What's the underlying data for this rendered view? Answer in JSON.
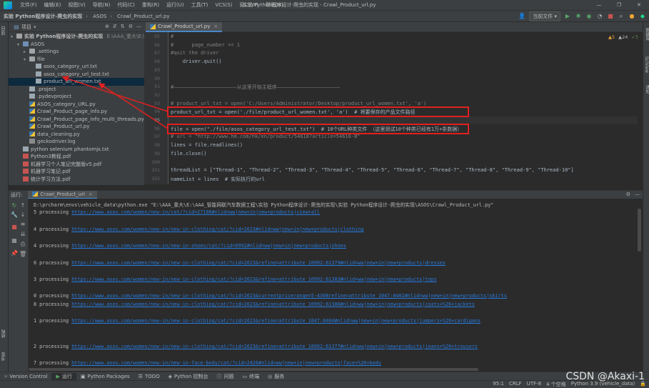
{
  "menubar": {
    "items": [
      "文件(F)",
      "编辑(E)",
      "视图(V)",
      "导航(N)",
      "代码(C)",
      "重构(R)",
      "运行(U)",
      "工具(T)",
      "VCS(S)",
      "窗口(W)",
      "帮助(H)"
    ],
    "title": "实验 Python程序设计-爬虫的实现 - Crawl_Product_url.py",
    "min": "—",
    "max": "❐",
    "close": "✕"
  },
  "navbar": {
    "crumbs": [
      "实验 Python程序设计-爬虫的实现",
      "ASOS",
      "Crawl_Product_url.py"
    ],
    "run_config": "当前文件 ▾"
  },
  "project": {
    "label": "项目",
    "root": "实验 Python程序设计-爬虫的实现",
    "root_path": "E:\\AAA_重大\\E:\\A",
    "items": [
      {
        "name": "ASOS",
        "indent": 1,
        "type": "folder-blue",
        "arrow": "▾"
      },
      {
        "name": ".settings",
        "indent": 2,
        "type": "folder",
        "arrow": "▸"
      },
      {
        "name": "file",
        "indent": 2,
        "type": "folder",
        "arrow": "▾"
      },
      {
        "name": "asos_category_url.txt",
        "indent": 3,
        "type": "txt",
        "arrow": ""
      },
      {
        "name": "asos_category_url_test.txt",
        "indent": 3,
        "type": "txt",
        "arrow": ""
      },
      {
        "name": "product_url_women.txt",
        "indent": 3,
        "type": "txt",
        "arrow": "",
        "selected": true
      },
      {
        "name": ".project",
        "indent": 2,
        "type": "txt",
        "arrow": ""
      },
      {
        "name": ".pydevproject",
        "indent": 2,
        "type": "txt",
        "arrow": ""
      },
      {
        "name": "ASOS_category_URL.py",
        "indent": 2,
        "type": "py",
        "arrow": ""
      },
      {
        "name": "Crawl_Product_page_info.py",
        "indent": 2,
        "type": "py",
        "arrow": ""
      },
      {
        "name": "Crawl_Product_page_info_multi_threads.py",
        "indent": 2,
        "type": "py",
        "arrow": ""
      },
      {
        "name": "Crawl_Product_url.py",
        "indent": 2,
        "type": "py",
        "arrow": ""
      },
      {
        "name": "data_cleaning.py",
        "indent": 2,
        "type": "py",
        "arrow": ""
      },
      {
        "name": "geckodriver.log",
        "indent": 2,
        "type": "log",
        "arrow": ""
      },
      {
        "name": "python selenium phantomjs.txt",
        "indent": 1,
        "type": "txt",
        "arrow": ""
      },
      {
        "name": "Python3教程.pdf",
        "indent": 1,
        "type": "pdf",
        "arrow": ""
      },
      {
        "name": "机器学习个人笔记完整版v5.pdf",
        "indent": 1,
        "type": "pdf",
        "arrow": ""
      },
      {
        "name": "机器学习笔记.pdf",
        "indent": 1,
        "type": "pdf",
        "arrow": ""
      },
      {
        "name": "统计学习方法.pdf",
        "indent": 1,
        "type": "pdf",
        "arrow": ""
      }
    ]
  },
  "editor": {
    "tab": "Crawl_Product_url.py",
    "inspections": {
      "warn1": "▲5",
      "warn2": "▲24",
      "ok": "✓3"
    },
    "lines": [
      {
        "n": "85",
        "text": "#",
        "cls": "cmt"
      },
      {
        "n": "86",
        "text": "#      page_number += 1",
        "cls": "cmt"
      },
      {
        "n": "87",
        "text": "#quit the driver",
        "cls": "cmt"
      },
      {
        "n": "88",
        "text": "    driver.quit()",
        "cls": ""
      },
      {
        "n": "89",
        "text": "",
        "cls": ""
      },
      {
        "n": "90",
        "text": "",
        "cls": ""
      },
      {
        "n": "91",
        "text": "#—————————————————————从这里开始主程序—————————————————————",
        "cls": "cmt"
      },
      {
        "n": "92",
        "text": "",
        "cls": ""
      },
      {
        "n": "93",
        "text": "# product_url_txt = open('C:/Users/Administrator/Desktop/product_url_women.txt', 'a')",
        "cls": "cmt"
      },
      {
        "n": "94",
        "text": "product_url_txt = open('./file/product_url_women.txt', 'a')  # 将要保存的产品文件路径",
        "cls": ""
      },
      {
        "n": "95",
        "text": "",
        "cls": "",
        "current": true
      },
      {
        "n": "96",
        "text": "file = open(\"./file/asos_category_url_test.txt\")  # 10个URL种类文件 （这里测试10个种类已经有1万+条数据）",
        "cls": ""
      },
      {
        "n": "97",
        "text": "# url = \"http://www.hm.com/hk/en/product/54618?article=54618-B\"",
        "cls": "cmt"
      },
      {
        "n": "98",
        "text": "lines = file.readlines()",
        "cls": ""
      },
      {
        "n": "99",
        "text": "file.close()",
        "cls": ""
      },
      {
        "n": "100",
        "text": "",
        "cls": ""
      },
      {
        "n": "101",
        "text": "threadList = [\"Thread-1\", \"Thread-2\", \"Thread-3\", \"Thread-4\", \"Thread-5\", \"Thread-6\", \"Thread-7\", \"Thread-8\", \"Thread-9\", \"Thread-10\"]",
        "cls": ""
      },
      {
        "n": "102",
        "text": "nameList = lines  # 实际执行的url",
        "cls": ""
      }
    ]
  },
  "run": {
    "label": "运行:",
    "tab": "Crawl_Product_url",
    "command": "D:\\prcharm\\envs\\vehicle_data\\python.exe \"E:\\AAA_重大\\E:\\AAA_智能网联汽车数据工程\\实验 Python程序设计-爬虫的实现\\实验 Python程序设计-爬虫的实现\\ASOS\\Crawl_Product_url.py\"",
    "lines": [
      {
        "prefix": "5 processing ",
        "url": "https://www.asos.com/women/new-in/cat/?cid=27108#nlid=ww|new+in|new+products|view+all"
      },
      {
        "prefix": "4 processing ",
        "url": "https://www.asos.com/women/new-in/new-in-clothing/cat/?cid=2623#nlid=ww|new+in|new+products|clothing"
      },
      {
        "prefix": "4 processing ",
        "url": "https://www.asos.com/women/new-in/new-in-shoes/cat/?cid=6992#nlid=ww|new+in|new+products|shoes"
      },
      {
        "prefix": "6 processing ",
        "url": "https://www.asos.com/women/new-in/new-in-clothing/cat/?cid=2623&refine=attribute_10992:61379#nlid=ww|new+in|new+products|dresses"
      },
      {
        "prefix": "3 processing ",
        "url": "https://www.asos.com/women/new-in/new-in-clothing/cat/?cid=2623&refine=attribute_10992:61383#nlid=ww|new+in|new+products|tops"
      },
      {
        "prefix": "0 processing ",
        "url": "https://www.asos.com/women/new-in/new-in-clothing/cat/?cid=2623&currentpricerange=5-4308refine=attribute_1047:8402#nlid=ww|new+in|new+products|skirts"
      },
      {
        "prefix": "8 processing ",
        "url": "https://www.asos.com/women/new-in/new-in-clothing/cat/?cid=2623&refine=attribute_10992:61380#nlid=ww|new+in|new+products|coats+%26+jackets"
      },
      {
        "prefix": "1 processing ",
        "url": "https://www.asos.com/women/new-in/new-in-clothing/cat/?cid=2623&refine=attribute_1047:8404#nlid=ww|new+in|new+products|jumpers+%26+cardigans"
      },
      {
        "prefix": "2 processing ",
        "url": "https://www.asos.com/women/new-in/new-in-clothing/cat/?cid=2623&refine=attribute_10992:61377#nlid=ww|new+in|new+products|jeans+%26+trousers"
      },
      {
        "prefix": "7 processing ",
        "url": "https://www.asos.com/women/new-in/new-in-face-body/cat/?cid=2426#nlid=ww|new+in|new+products|face+%26+body"
      }
    ]
  },
  "bottom_tabs": [
    "Version Control",
    "运行",
    "Python Packages",
    "TODO",
    "Python 控制台",
    "问题",
    "终端",
    "服务"
  ],
  "statusbar": {
    "message": "",
    "position": "95:1",
    "line_sep": "CRLF",
    "encoding": "UTF-8",
    "indent": "4 个空格",
    "interpreter": "Python 3.9 (vehicle_data)"
  },
  "watermark": "CSDN @Akaxi-1",
  "colors": {
    "highlight_box": "#e02020",
    "accent": "#4a88c7",
    "link": "#287bde"
  }
}
